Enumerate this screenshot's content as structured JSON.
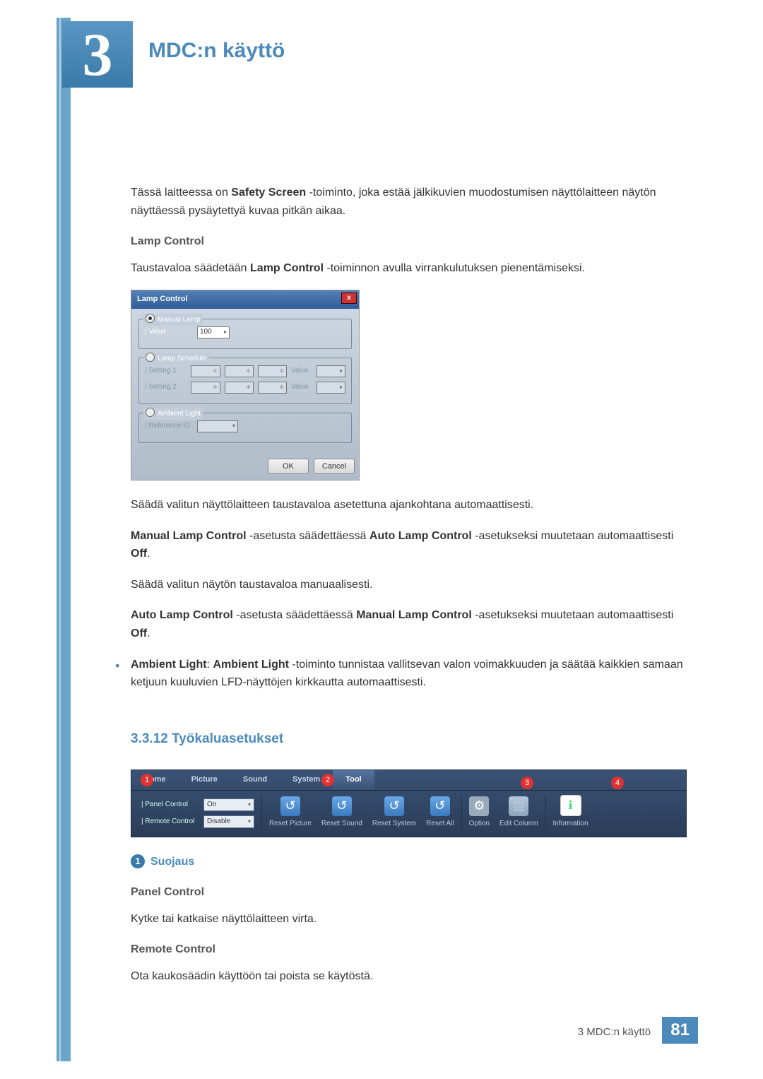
{
  "chapter": {
    "num": "3",
    "title": "MDC:n käyttö"
  },
  "p1": "Tässä laitteessa on ",
  "p1b": "Safety Screen",
  "p1c": " -toiminto, joka estää jälkikuvien muodostumisen näyttölaitteen näytön näyttäessä pysäytettyä kuvaa pitkän aikaa.",
  "lamp_head": "Lamp Control",
  "p2": "Taustavaloa säädetään ",
  "p2b": "Lamp Control",
  "p2c": " -toiminnon avulla virrankulutuksen pienentämiseksi.",
  "dlg": {
    "title": "Lamp Control",
    "x": "x",
    "manual": "Manual Lamp",
    "value_lbl": "Value",
    "value": "100",
    "sched": "Lamp Schedule",
    "s1": "Setting 1",
    "s2": "Setting 2",
    "vl": "Value",
    "amb": "Ambient Light",
    "ref": "Reference ID",
    "ok": "OK",
    "cancel": "Cancel"
  },
  "p3": "Säädä valitun näyttölaitteen taustavaloa asetettuna ajankohtana automaattisesti.",
  "p4a": "Manual Lamp Control",
  "p4b": " -asetusta säädettäessä ",
  "p4c": "Auto Lamp Control",
  "p4d": " -asetukseksi muutetaan automaattisesti ",
  "p4e": "Off",
  "p4f": ".",
  "p5": "Säädä valitun näytön taustavaloa manuaalisesti.",
  "p6a": "Auto Lamp Control",
  "p6b": " -asetusta säädettäessä ",
  "p6c": "Manual Lamp Control",
  "p6d": " -asetukseksi muutetaan automaattisesti ",
  "p6e": "Off",
  "p6f": ".",
  "p7a": "Ambient Light",
  "p7b": ": ",
  "p7c": "Ambient Light",
  "p7d": " -toiminto tunnistaa vallitsevan valon voimakkuuden ja säätää kaikkien samaan ketjuun kuuluvien LFD-näyttöjen kirkkautta automaattisesti.",
  "section": "3.3.12   Työkaluasetukset",
  "tb": {
    "tabs": [
      "Home",
      "Picture",
      "Sound",
      "System",
      "Tool"
    ],
    "pc": "Panel Control",
    "pc_v": "On",
    "rc": "Remote Control",
    "rc_v": "Disable",
    "rp": "Reset Picture",
    "rs": "Reset Sound",
    "ry": "Reset System",
    "ra": "Reset All",
    "op": "Option",
    "ed": "Edit Column",
    "inf": "Information"
  },
  "callouts": {
    "c1": "1",
    "c2": "2",
    "c3": "3",
    "c4": "4"
  },
  "suojaus": "Suojaus",
  "pc_head": "Panel Control",
  "pc_txt": "Kytke tai katkaise näyttölaitteen virta.",
  "rc_head": "Remote Control",
  "rc_txt": "Ota kaukosäädin käyttöön tai poista se käytöstä.",
  "footer": "3 MDC:n käyttö",
  "pagenum": "81"
}
